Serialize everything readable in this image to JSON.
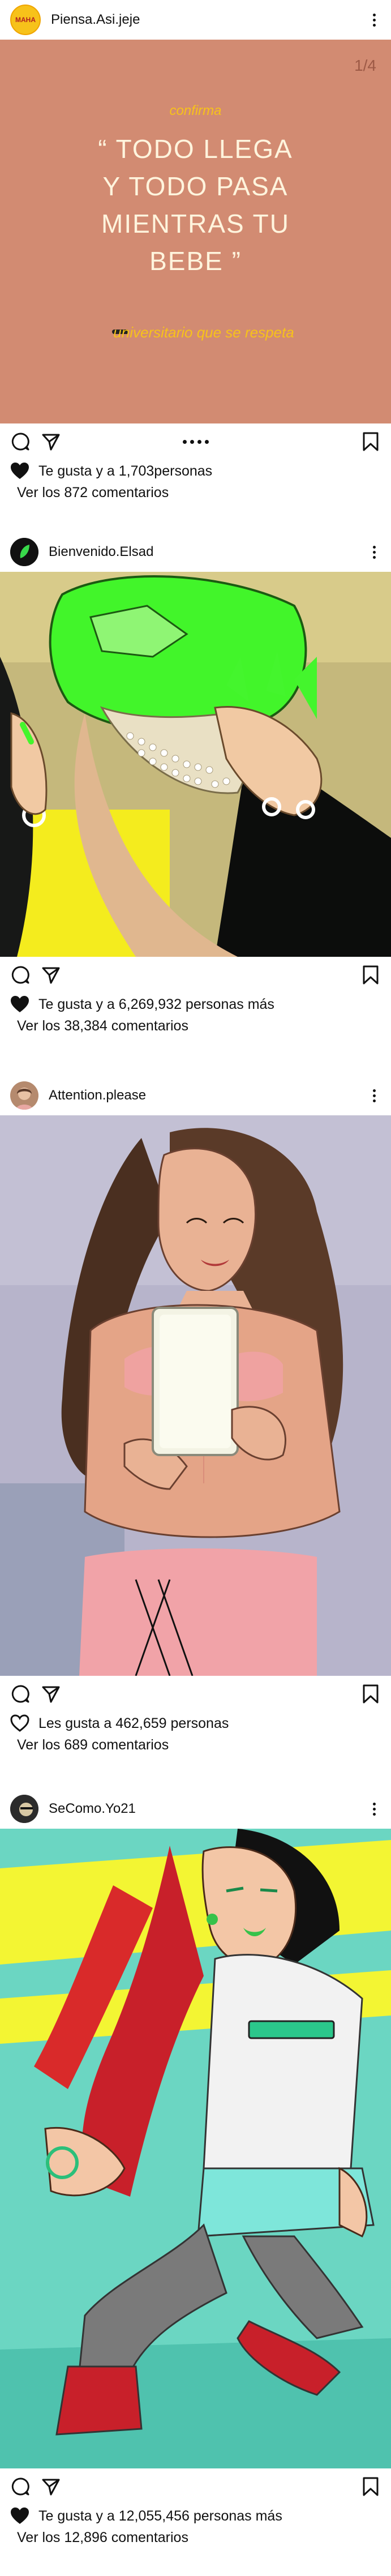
{
  "posts": [
    {
      "username": "Piensa.Asi.jeje",
      "avatar_text": "MAHA",
      "slide_counter": "1/4",
      "card": {
        "small_text": "confirma",
        "main_lines": [
          "“ TODO LLEGA",
          "Y TODO PASA",
          "MIENTRAS TU",
          "BEBE ”"
        ],
        "signature": "universitario que se respeta"
      },
      "likes": "Te gusta y a 1,703personas",
      "comments": "Ver los 872 comentarios"
    },
    {
      "username": "Bienvenido.Elsad",
      "likes": "Te gusta y a 6,269,932 personas más",
      "comments": "Ver los 38,384 comentarios"
    },
    {
      "username": "Attention.please",
      "likes": "Les gusta a 462,659 personas",
      "comments": "Ver los 689 comentarios"
    },
    {
      "username": "SeComo.Yo21",
      "likes": "Te gusta y a 12,055,456 personas más",
      "comments": "Ver los 12,896 comentarios"
    }
  ],
  "icons": {
    "more": "more-vertical-icon",
    "comment": "comment-icon",
    "share": "send-icon",
    "bookmark": "bookmark-icon",
    "heart_filled": "heart-filled-icon",
    "heart_outline": "heart-outline-icon"
  },
  "colors": {
    "card_bg": "#d28b72",
    "card_accent": "#f7c21a",
    "card_text": "#fff4dd"
  }
}
